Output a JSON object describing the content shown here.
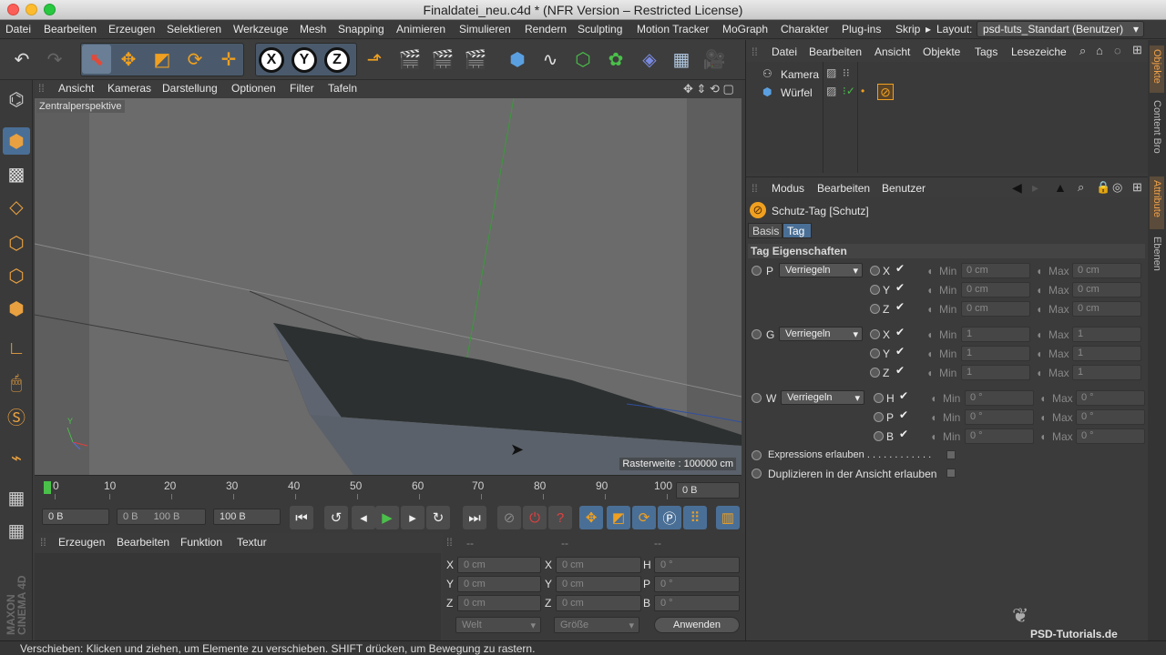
{
  "window": {
    "title": "Finaldatei_neu.c4d * (NFR Version – Restricted License)"
  },
  "menubar": {
    "items": [
      "Datei",
      "Bearbeiten",
      "Erzeugen",
      "Selektieren",
      "Werkzeuge",
      "Mesh",
      "Snapping",
      "Animieren",
      "Simulieren",
      "Rendern",
      "Sculpting",
      "Motion Tracker",
      "MoGraph",
      "Charakter",
      "Plug-ins",
      "Skrip"
    ],
    "layout_label": "Layout:",
    "layout_value": "psd-tuts_Standart (Benutzer)"
  },
  "viewport": {
    "menu": [
      "Ansicht",
      "Kameras",
      "Darstellung",
      "Optionen",
      "Filter",
      "Tafeln"
    ],
    "projection": "Zentralperspektive",
    "raster": "Rasterweite : 100000 cm"
  },
  "timeline": {
    "ticks": [
      "0",
      "10",
      "20",
      "30",
      "40",
      "50",
      "60",
      "70",
      "80",
      "90",
      "100"
    ],
    "frame_field": "0 B",
    "start": "0 B",
    "range_start": "0 B",
    "range_end": "100 B",
    "end": "100 B"
  },
  "materials": {
    "menu": [
      "Erzeugen",
      "Bearbeiten",
      "Funktion",
      "Textur"
    ]
  },
  "coordinates": {
    "headers": [
      "--",
      "--",
      "--"
    ],
    "rows": [
      {
        "a": "X",
        "av": "0 cm",
        "b": "X",
        "bv": "0 cm",
        "c": "H",
        "cv": "0 °"
      },
      {
        "a": "Y",
        "av": "0 cm",
        "b": "Y",
        "bv": "0 cm",
        "c": "P",
        "cv": "0 °"
      },
      {
        "a": "Z",
        "av": "0 cm",
        "b": "Z",
        "bv": "0 cm",
        "c": "B",
        "cv": "0 °"
      }
    ],
    "mode": "Welt",
    "size": "Größe",
    "apply": "Anwenden"
  },
  "objects": {
    "menu": [
      "Datei",
      "Bearbeiten",
      "Ansicht",
      "Objekte",
      "Tags",
      "Lesezeiche"
    ],
    "items": [
      "Kamera",
      "Würfel"
    ]
  },
  "attributes": {
    "menu": [
      "Modus",
      "Bearbeiten",
      "Benutzer"
    ],
    "title": "Schutz-Tag [Schutz]",
    "tabs": [
      "Basis",
      "Tag"
    ],
    "section": "Tag Eigenschaften",
    "groups": [
      {
        "key": "P",
        "mode": "Verriegeln",
        "rows": [
          {
            "axis": "X",
            "min": "0 cm",
            "max": "0 cm"
          },
          {
            "axis": "Y",
            "min": "0 cm",
            "max": "0 cm"
          },
          {
            "axis": "Z",
            "min": "0 cm",
            "max": "0 cm"
          }
        ]
      },
      {
        "key": "G",
        "mode": "Verriegeln",
        "rows": [
          {
            "axis": "X",
            "min": "1",
            "max": "1"
          },
          {
            "axis": "Y",
            "min": "1",
            "max": "1"
          },
          {
            "axis": "Z",
            "min": "1",
            "max": "1"
          }
        ]
      },
      {
        "key": "W",
        "mode": "Verriegeln",
        "rows": [
          {
            "axis": "H",
            "min": "0 °",
            "max": "0 °"
          },
          {
            "axis": "P",
            "min": "0 °",
            "max": "0 °"
          },
          {
            "axis": "B",
            "min": "0 °",
            "max": "0 °"
          }
        ]
      }
    ],
    "min_label": "Min",
    "max_label": "Max",
    "expr": "Expressions erlauben . . . . . . . . . . . .",
    "dup": "Duplizieren in der Ansicht erlauben"
  },
  "side_tabs": [
    "Objekte",
    "Content Bro",
    "Attribute",
    "Ebenen"
  ],
  "brand": {
    "vertical": "MAXON CINEMA 4D",
    "watermark": "PSD-Tutorials.de"
  },
  "status": "Verschieben: Klicken und ziehen, um Elemente zu verschieben. SHIFT drücken, um Bewegung zu rastern."
}
